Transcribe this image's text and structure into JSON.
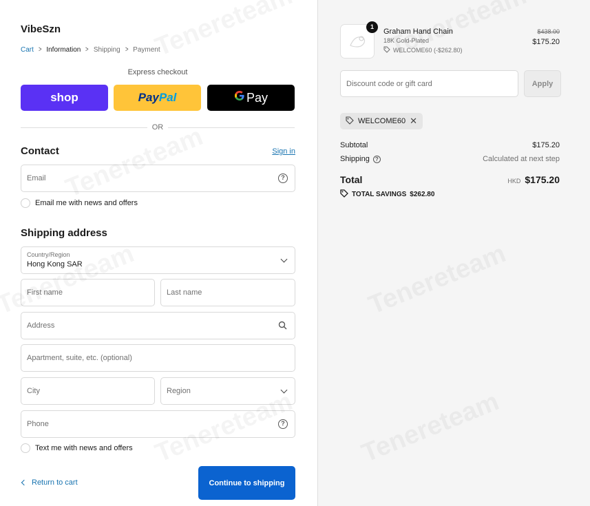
{
  "store": {
    "name": "VibeSzn"
  },
  "breadcrumb": [
    {
      "label": "Cart",
      "state": "link"
    },
    {
      "label": "Information",
      "state": "current"
    },
    {
      "label": "Shipping",
      "state": "upcoming"
    },
    {
      "label": "Payment",
      "state": "upcoming"
    }
  ],
  "express": {
    "label": "Express checkout",
    "shop": "shop",
    "paypal_a": "Pay",
    "paypal_b": "Pal",
    "gpay_g": "G",
    "gpay_text": "Pay",
    "or": "OR"
  },
  "contact": {
    "title": "Contact",
    "signin": "Sign in",
    "email_placeholder": "Email",
    "email_optin": "Email me with news and offers"
  },
  "shipping": {
    "title": "Shipping address",
    "country_label": "Country/Region",
    "country_value": "Hong Kong SAR",
    "first_name": "First name",
    "last_name": "Last name",
    "address": "Address",
    "apartment": "Apartment, suite, etc. (optional)",
    "city": "City",
    "region": "Region",
    "phone": "Phone",
    "sms_optin": "Text me with news and offers"
  },
  "actions": {
    "return": "Return to cart",
    "continue": "Continue to shipping"
  },
  "summary": {
    "product": {
      "qty": "1",
      "name": "Graham Hand Chain",
      "variant": "18K Gold-Plated",
      "discount": "WELCOME60 (-$262.80)",
      "old_price": "$438.00",
      "price": "$175.20"
    },
    "discount_placeholder": "Discount code or gift card",
    "apply": "Apply",
    "applied_code": "WELCOME60",
    "subtotal_label": "Subtotal",
    "subtotal_value": "$175.20",
    "shipping_label": "Shipping",
    "shipping_value": "Calculated at next step",
    "total_label": "Total",
    "total_currency": "HKD",
    "total_value": "$175.20",
    "savings_label": "TOTAL SAVINGS",
    "savings_value": "$262.80"
  },
  "colors": {
    "accent": "#1773b0",
    "primary_button": "#0b63d0",
    "shop_pay": "#5a31f4",
    "paypal": "#ffc439"
  },
  "watermark": "Tenereteam"
}
